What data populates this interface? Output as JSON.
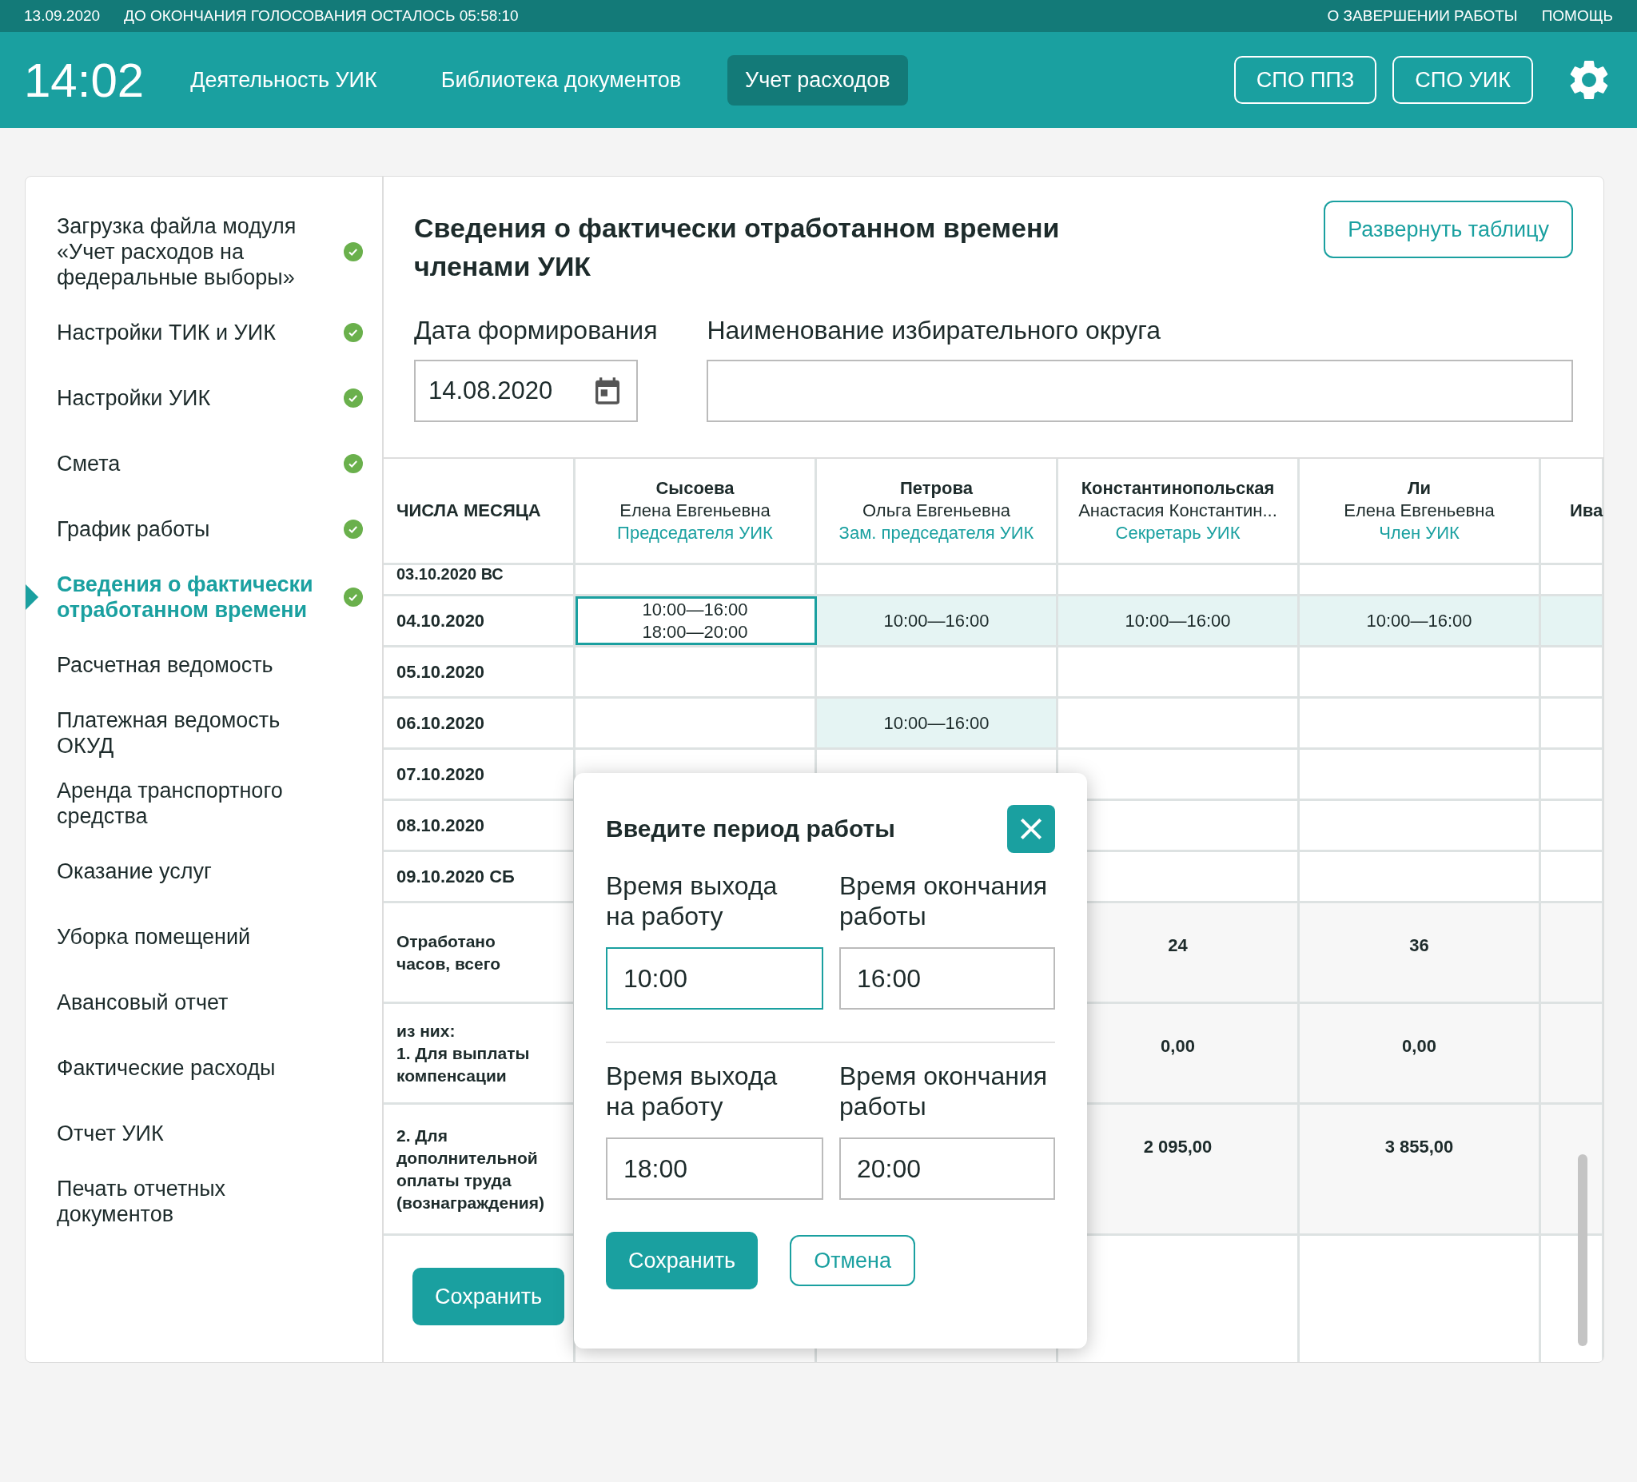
{
  "topbar": {
    "date": "13.09.2020",
    "countdown": "ДО ОКОНЧАНИЯ ГОЛОСОВАНИЯ ОСТАЛОСЬ 05:58:10",
    "links": [
      "О ЗАВЕРШЕНИИ РАБОТЫ",
      "ПОМОЩЬ"
    ]
  },
  "header": {
    "clock": "14:02",
    "nav": [
      {
        "label": "Деятельность УИК",
        "selected": false
      },
      {
        "label": "Библиотека документов",
        "selected": false
      },
      {
        "label": "Учет расходов",
        "selected": true
      }
    ],
    "buttons": [
      "СПО ППЗ",
      "СПО УИК"
    ]
  },
  "sidebar": {
    "items": [
      {
        "label": "Загрузка файла модуля «Учет расходов на федеральные выборы»",
        "done": true,
        "selected": false
      },
      {
        "label": "Настройки ТИК и УИК",
        "done": true,
        "selected": false
      },
      {
        "label": "Настройки УИК",
        "done": true,
        "selected": false
      },
      {
        "label": "Смета",
        "done": true,
        "selected": false
      },
      {
        "label": "График работы",
        "done": true,
        "selected": false
      },
      {
        "label": "Сведения о фактически отработанном времени",
        "done": true,
        "selected": true
      },
      {
        "label": "Расчетная ведомость",
        "done": false,
        "selected": false
      },
      {
        "label": "Платежная ведомость ОКУД",
        "done": false,
        "selected": false
      },
      {
        "label": "Аренда транспортного средства",
        "done": false,
        "selected": false
      },
      {
        "label": "Оказание услуг",
        "done": false,
        "selected": false
      },
      {
        "label": "Уборка помещений",
        "done": false,
        "selected": false
      },
      {
        "label": "Авансовый отчет",
        "done": false,
        "selected": false
      },
      {
        "label": "Фактические расходы",
        "done": false,
        "selected": false
      },
      {
        "label": "Отчет УИК",
        "done": false,
        "selected": false
      },
      {
        "label": "Печать отчетных документов",
        "done": false,
        "selected": false
      }
    ]
  },
  "main": {
    "title": "Сведения о фактически отработанном времени членами УИК",
    "expand_button": "Развернуть таблицу",
    "date_field": {
      "label": "Дата формирования",
      "value": "14.08.2020"
    },
    "district_field": {
      "label": "Наименование избирательного округа"
    },
    "table": {
      "first_column": "ЧИСЛА МЕСЯЦА",
      "columns": [
        {
          "surname": "Сысоева",
          "name": "Елена Евгеньевна",
          "role": "Председателя УИК"
        },
        {
          "surname": "Петрова",
          "name": "Ольга Евгеньевна",
          "role": "Зам. председателя УИК"
        },
        {
          "surname": "Константинопольская",
          "name": "Анастасия Константин...",
          "role": "Секретарь УИК"
        },
        {
          "surname": "Ли",
          "name": "Елена Евгеньевна",
          "role": "Член УИК"
        },
        {
          "surname": "Ива"
        }
      ],
      "rows": [
        {
          "kind": "partial",
          "label": "03.10.2020 ВС",
          "cells": [
            {
              "filled": false,
              "selected": false
            },
            {
              "filled": false,
              "selected": false
            },
            {
              "filled": false,
              "selected": false
            },
            {
              "filled": false,
              "selected": false
            },
            {
              "filled": false,
              "selected": false
            }
          ]
        },
        {
          "kind": "date",
          "label": "04.10.2020",
          "cells": [
            {
              "lines": [
                "10:00—16:00",
                "18:00—20:00"
              ],
              "filled": false,
              "selected": true
            },
            {
              "lines": [
                "10:00—16:00"
              ],
              "filled": true,
              "selected": false
            },
            {
              "lines": [
                "10:00—16:00"
              ],
              "filled": true,
              "selected": false
            },
            {
              "lines": [
                "10:00—16:00"
              ],
              "filled": true,
              "selected": false
            },
            {
              "filled": true,
              "selected": false
            }
          ]
        },
        {
          "kind": "date",
          "label": "05.10.2020",
          "cells": [
            {
              "filled": false,
              "selected": false
            },
            {
              "filled": false,
              "selected": false
            },
            {
              "filled": false,
              "selected": false
            },
            {
              "filled": false,
              "selected": false
            },
            {
              "filled": false,
              "selected": false
            }
          ]
        },
        {
          "kind": "date",
          "label": "06.10.2020",
          "cells": [
            {
              "filled": false,
              "selected": false
            },
            {
              "lines": [
                "10:00—16:00"
              ],
              "filled": true,
              "selected": false
            },
            {
              "filled": false,
              "selected": false
            },
            {
              "filled": false,
              "selected": false
            },
            {
              "filled": false,
              "selected": false
            }
          ]
        },
        {
          "kind": "date",
          "label": "07.10.2020",
          "cells": [
            {
              "filled": false,
              "selected": false
            },
            {
              "filled": false,
              "selected": false
            },
            {
              "filled": false,
              "selected": false
            },
            {
              "filled": false,
              "selected": false
            },
            {
              "filled": false,
              "selected": false
            }
          ]
        },
        {
          "kind": "date",
          "label": "08.10.2020",
          "cells": [
            {},
            {},
            {
              "filled": false,
              "selected": false
            },
            {
              "filled": false,
              "selected": false
            },
            {
              "filled": false,
              "selected": false
            }
          ]
        },
        {
          "kind": "date",
          "label": "09.10.2020 СБ",
          "cells": [
            {},
            {},
            {
              "filled": false,
              "selected": false
            },
            {
              "filled": false,
              "selected": false
            },
            {
              "filled": false,
              "selected": false
            }
          ]
        },
        {
          "kind": "total",
          "label": "Отработано часов, всего",
          "cells": [
            {},
            {},
            {
              "lines": [
                "24"
              ]
            },
            {
              "lines": [
                "36"
              ]
            },
            {}
          ]
        },
        {
          "kind": "total",
          "label": "из них:\n1. Для выплаты компенсации",
          "cells": [
            {},
            {},
            {
              "lines": [
                "0,00"
              ]
            },
            {
              "lines": [
                "0,00"
              ]
            },
            {}
          ]
        },
        {
          "kind": "total_tall",
          "label": "2. Для дополнительной оплаты труда (вознаграждения)",
          "cells": [
            {},
            {},
            {
              "lines": [
                "2 095,00"
              ]
            },
            {
              "lines": [
                "3 855,00"
              ]
            },
            {}
          ]
        }
      ]
    },
    "save_button": "Сохранить"
  },
  "modal": {
    "title": "Введите период работы",
    "periods": [
      {
        "fields": [
          {
            "label": "Время выхода на работу",
            "value": "10:00",
            "focused": true
          },
          {
            "label": "Время окончания работы",
            "value": "16:00",
            "focused": false
          }
        ]
      },
      {
        "fields": [
          {
            "label": "Время выхода на работу",
            "value": "18:00",
            "focused": false
          },
          {
            "label": "Время окончания работы",
            "value": "20:00",
            "focused": false
          }
        ]
      }
    ],
    "save_button": "Сохранить",
    "cancel_button": "Отмена"
  }
}
